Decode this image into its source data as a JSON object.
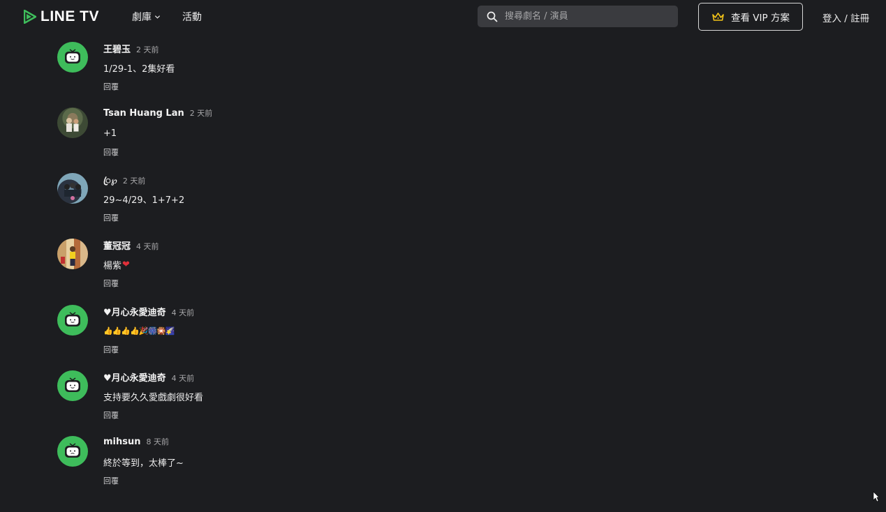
{
  "brand": {
    "name": "LINE TV",
    "accent": "#3ebc5b"
  },
  "nav": {
    "drama_label": "劇庫",
    "events_label": "活動"
  },
  "search": {
    "placeholder": "搜尋劇名 / 演員",
    "value": ""
  },
  "vip": {
    "label": "查看 VIP 方案",
    "icon": "crown-icon",
    "icon_color": "#f2c318"
  },
  "auth": {
    "label": "登入 / 註冊"
  },
  "comments": [
    {
      "author": "王碧玉",
      "time": "2 天前",
      "text": "1/29-1、2集好看",
      "reply": "回覆",
      "avatar": "line-tv-mascot"
    },
    {
      "author": "Tsan Huang Lan",
      "time": "2 天前",
      "text": "+1",
      "reply": "回覆",
      "avatar": "user-photo"
    },
    {
      "author": "ꦿ℘",
      "time": "2 天前",
      "text": "29~4/29、1+7+2",
      "reply": "回覆",
      "avatar": "user-photo"
    },
    {
      "author": "董冠冠",
      "time": "4 天前",
      "text": "楊紫",
      "text_emoji": "❤",
      "reply": "回覆",
      "avatar": "user-photo"
    },
    {
      "author": "♥月心永愛迪奇",
      "time": "4 天前",
      "text": "👍👍👍👍🎉🎆🎇🌠",
      "reply": "回覆",
      "avatar": "line-tv-mascot"
    },
    {
      "author": "♥月心永愛迪奇",
      "time": "4 天前",
      "text": "支持要久久愛戲劇很好看",
      "reply": "回覆",
      "avatar": "line-tv-mascot"
    },
    {
      "author": "mihsun",
      "time": "8 天前",
      "text": "終於等到，太棒了~",
      "reply": "回覆",
      "avatar": "line-tv-mascot"
    }
  ]
}
